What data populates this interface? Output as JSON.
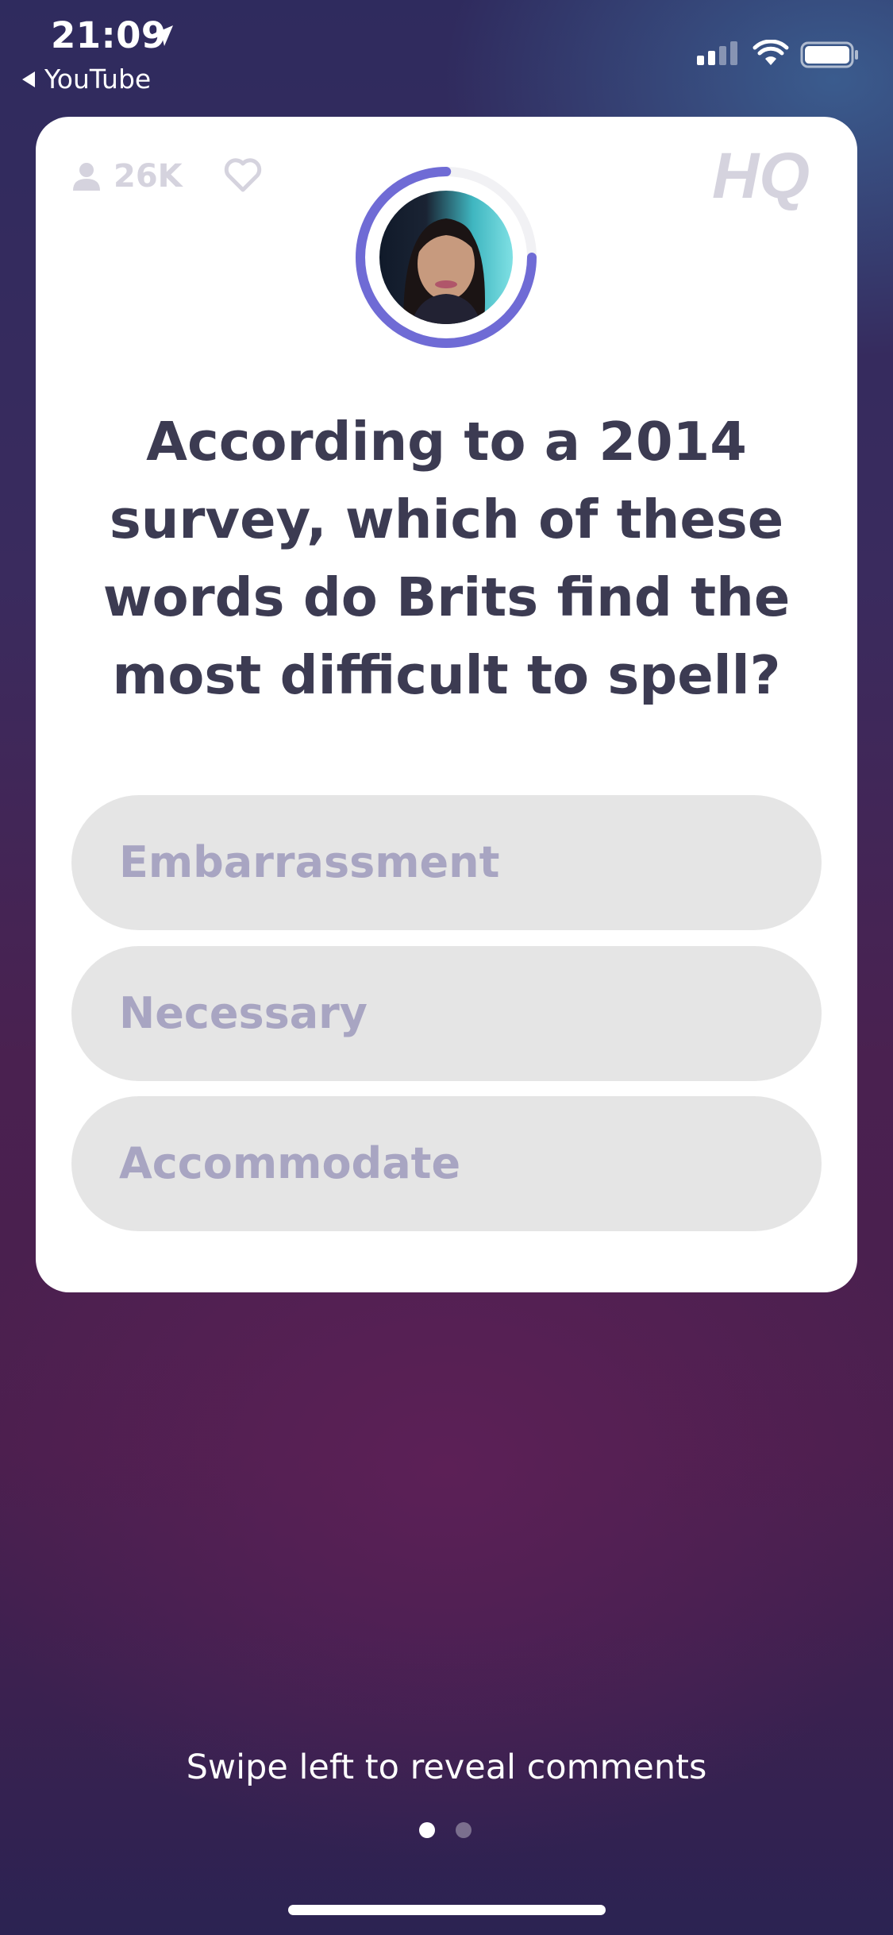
{
  "status_bar": {
    "time": "21:09",
    "back_label": "YouTube"
  },
  "header": {
    "viewer_count": "26K",
    "logo_text": "HQ"
  },
  "question": {
    "text": "According to a 2014 survey, which of these words do Brits find the most difficult to spell?",
    "timer_progress": 0.75
  },
  "answers": [
    {
      "label": "Embarrassment"
    },
    {
      "label": "Necessary"
    },
    {
      "label": "Accommodate"
    }
  ],
  "footer": {
    "hint": "Swipe left to reveal comments",
    "page_count": 2,
    "active_page": 1
  },
  "colors": {
    "accent": "#6f6bd5",
    "question_text": "#3c3b52",
    "answer_bg": "#e5e5e5",
    "answer_text": "#a8a5c2",
    "muted_icon": "#d5d3de"
  }
}
